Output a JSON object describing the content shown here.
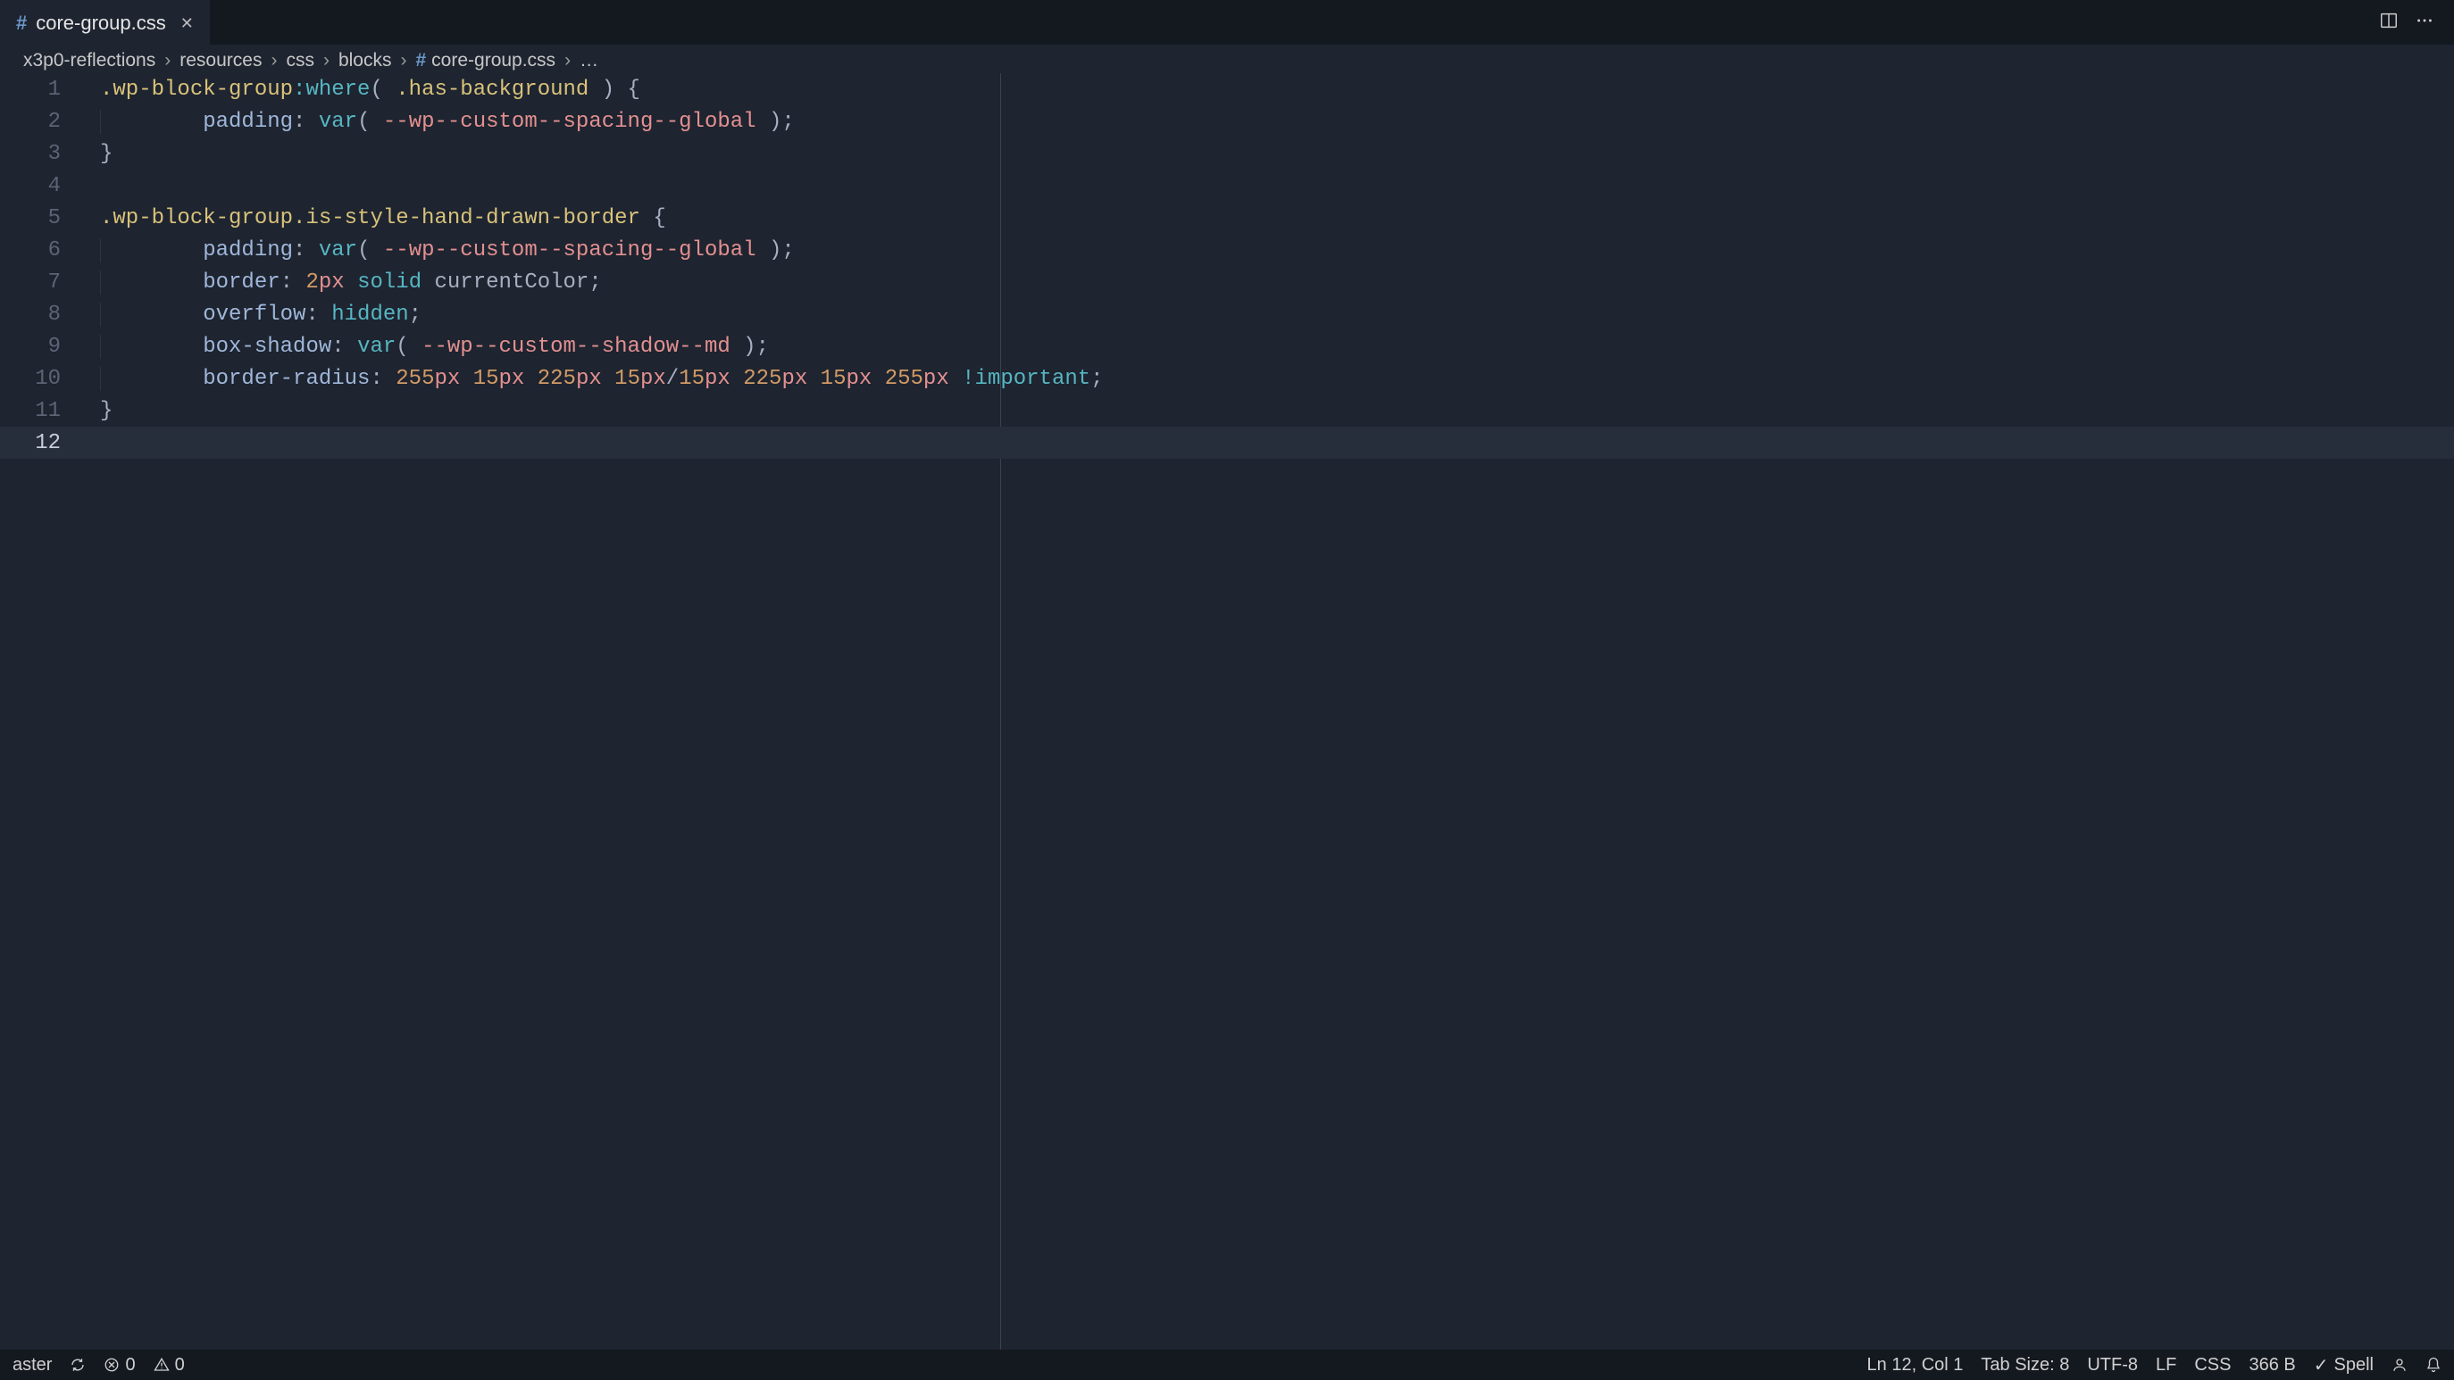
{
  "tab": {
    "filename": "core-group.css",
    "icon": "#"
  },
  "breadcrumbs": {
    "items": [
      "x3p0-reflections",
      "resources",
      "css",
      "blocks"
    ],
    "file_icon": "#",
    "filename": "core-group.css",
    "trail": "…"
  },
  "editor": {
    "ruler_column": 80,
    "total_lines": 12,
    "current_line": 12,
    "lines": [
      {
        "n": 1,
        "tokens": [
          {
            "t": ".wp-block-group",
            "c": "c-sel"
          },
          {
            "t": ":where",
            "c": "c-pseudo"
          },
          {
            "t": "(",
            "c": "c-punc"
          },
          {
            "t": " ",
            "c": "c-punc"
          },
          {
            "t": ".has-background",
            "c": "c-sel"
          },
          {
            "t": " ",
            "c": "c-punc"
          },
          {
            "t": ")",
            "c": "c-punc"
          },
          {
            "t": " ",
            "c": "c-punc"
          },
          {
            "t": "{",
            "c": "c-punc"
          }
        ]
      },
      {
        "n": 2,
        "indent": 1,
        "tokens": [
          {
            "t": "        ",
            "c": "c-punc"
          },
          {
            "t": "padding",
            "c": "c-prop"
          },
          {
            "t": ":",
            "c": "c-punc"
          },
          {
            "t": " ",
            "c": "c-punc"
          },
          {
            "t": "var",
            "c": "c-func"
          },
          {
            "t": "(",
            "c": "c-punc"
          },
          {
            "t": " ",
            "c": "c-punc"
          },
          {
            "t": "--wp--custom--spacing--global",
            "c": "c-var"
          },
          {
            "t": " ",
            "c": "c-punc"
          },
          {
            "t": ")",
            "c": "c-punc"
          },
          {
            "t": ";",
            "c": "c-punc"
          }
        ]
      },
      {
        "n": 3,
        "tokens": [
          {
            "t": "}",
            "c": "c-punc"
          }
        ]
      },
      {
        "n": 4,
        "tokens": []
      },
      {
        "n": 5,
        "tokens": [
          {
            "t": ".wp-block-group.is-style-hand-drawn-border",
            "c": "c-sel"
          },
          {
            "t": " ",
            "c": "c-punc"
          },
          {
            "t": "{",
            "c": "c-punc"
          }
        ]
      },
      {
        "n": 6,
        "indent": 1,
        "tokens": [
          {
            "t": "        ",
            "c": "c-punc"
          },
          {
            "t": "padding",
            "c": "c-prop"
          },
          {
            "t": ":",
            "c": "c-punc"
          },
          {
            "t": " ",
            "c": "c-punc"
          },
          {
            "t": "var",
            "c": "c-func"
          },
          {
            "t": "(",
            "c": "c-punc"
          },
          {
            "t": " ",
            "c": "c-punc"
          },
          {
            "t": "--wp--custom--spacing--global",
            "c": "c-var"
          },
          {
            "t": " ",
            "c": "c-punc"
          },
          {
            "t": ")",
            "c": "c-punc"
          },
          {
            "t": ";",
            "c": "c-punc"
          }
        ]
      },
      {
        "n": 7,
        "indent": 1,
        "tokens": [
          {
            "t": "        ",
            "c": "c-punc"
          },
          {
            "t": "border",
            "c": "c-prop"
          },
          {
            "t": ":",
            "c": "c-punc"
          },
          {
            "t": " ",
            "c": "c-punc"
          },
          {
            "t": "2",
            "c": "c-num"
          },
          {
            "t": "px",
            "c": "c-unit"
          },
          {
            "t": " ",
            "c": "c-punc"
          },
          {
            "t": "solid",
            "c": "c-kw"
          },
          {
            "t": " ",
            "c": "c-punc"
          },
          {
            "t": "currentColor",
            "c": "c-val"
          },
          {
            "t": ";",
            "c": "c-punc"
          }
        ]
      },
      {
        "n": 8,
        "indent": 1,
        "tokens": [
          {
            "t": "        ",
            "c": "c-punc"
          },
          {
            "t": "overflow",
            "c": "c-prop"
          },
          {
            "t": ":",
            "c": "c-punc"
          },
          {
            "t": " ",
            "c": "c-punc"
          },
          {
            "t": "hidden",
            "c": "c-kw"
          },
          {
            "t": ";",
            "c": "c-punc"
          }
        ]
      },
      {
        "n": 9,
        "indent": 1,
        "tokens": [
          {
            "t": "        ",
            "c": "c-punc"
          },
          {
            "t": "box-shadow",
            "c": "c-prop"
          },
          {
            "t": ":",
            "c": "c-punc"
          },
          {
            "t": " ",
            "c": "c-punc"
          },
          {
            "t": "var",
            "c": "c-func"
          },
          {
            "t": "(",
            "c": "c-punc"
          },
          {
            "t": " ",
            "c": "c-punc"
          },
          {
            "t": "--wp--custom--shadow--md",
            "c": "c-var"
          },
          {
            "t": " ",
            "c": "c-punc"
          },
          {
            "t": ")",
            "c": "c-punc"
          },
          {
            "t": ";",
            "c": "c-punc"
          }
        ]
      },
      {
        "n": 10,
        "indent": 1,
        "tokens": [
          {
            "t": "        ",
            "c": "c-punc"
          },
          {
            "t": "border-radius",
            "c": "c-prop"
          },
          {
            "t": ":",
            "c": "c-punc"
          },
          {
            "t": " ",
            "c": "c-punc"
          },
          {
            "t": "255",
            "c": "c-num"
          },
          {
            "t": "px",
            "c": "c-unit"
          },
          {
            "t": " ",
            "c": "c-punc"
          },
          {
            "t": "15",
            "c": "c-num"
          },
          {
            "t": "px",
            "c": "c-unit"
          },
          {
            "t": " ",
            "c": "c-punc"
          },
          {
            "t": "225",
            "c": "c-num"
          },
          {
            "t": "px",
            "c": "c-unit"
          },
          {
            "t": " ",
            "c": "c-punc"
          },
          {
            "t": "15",
            "c": "c-num"
          },
          {
            "t": "px",
            "c": "c-unit"
          },
          {
            "t": "/",
            "c": "c-punc"
          },
          {
            "t": "15",
            "c": "c-num"
          },
          {
            "t": "px",
            "c": "c-unit"
          },
          {
            "t": " ",
            "c": "c-punc"
          },
          {
            "t": "225",
            "c": "c-num"
          },
          {
            "t": "px",
            "c": "c-unit"
          },
          {
            "t": " ",
            "c": "c-punc"
          },
          {
            "t": "15",
            "c": "c-num"
          },
          {
            "t": "px",
            "c": "c-unit"
          },
          {
            "t": " ",
            "c": "c-punc"
          },
          {
            "t": "255",
            "c": "c-num"
          },
          {
            "t": "px",
            "c": "c-unit"
          },
          {
            "t": " ",
            "c": "c-punc"
          },
          {
            "t": "!important",
            "c": "c-imp"
          },
          {
            "t": ";",
            "c": "c-punc"
          }
        ]
      },
      {
        "n": 11,
        "tokens": [
          {
            "t": "}",
            "c": "c-punc"
          }
        ]
      },
      {
        "n": 12,
        "tokens": []
      }
    ]
  },
  "status": {
    "branch": "aster",
    "errors": "0",
    "warnings": "0",
    "cursor": "Ln 12, Col 1",
    "tab_size": "Tab Size: 8",
    "encoding": "UTF-8",
    "eol": "LF",
    "language": "CSS",
    "file_size": "366 B",
    "spell": "Spell"
  }
}
